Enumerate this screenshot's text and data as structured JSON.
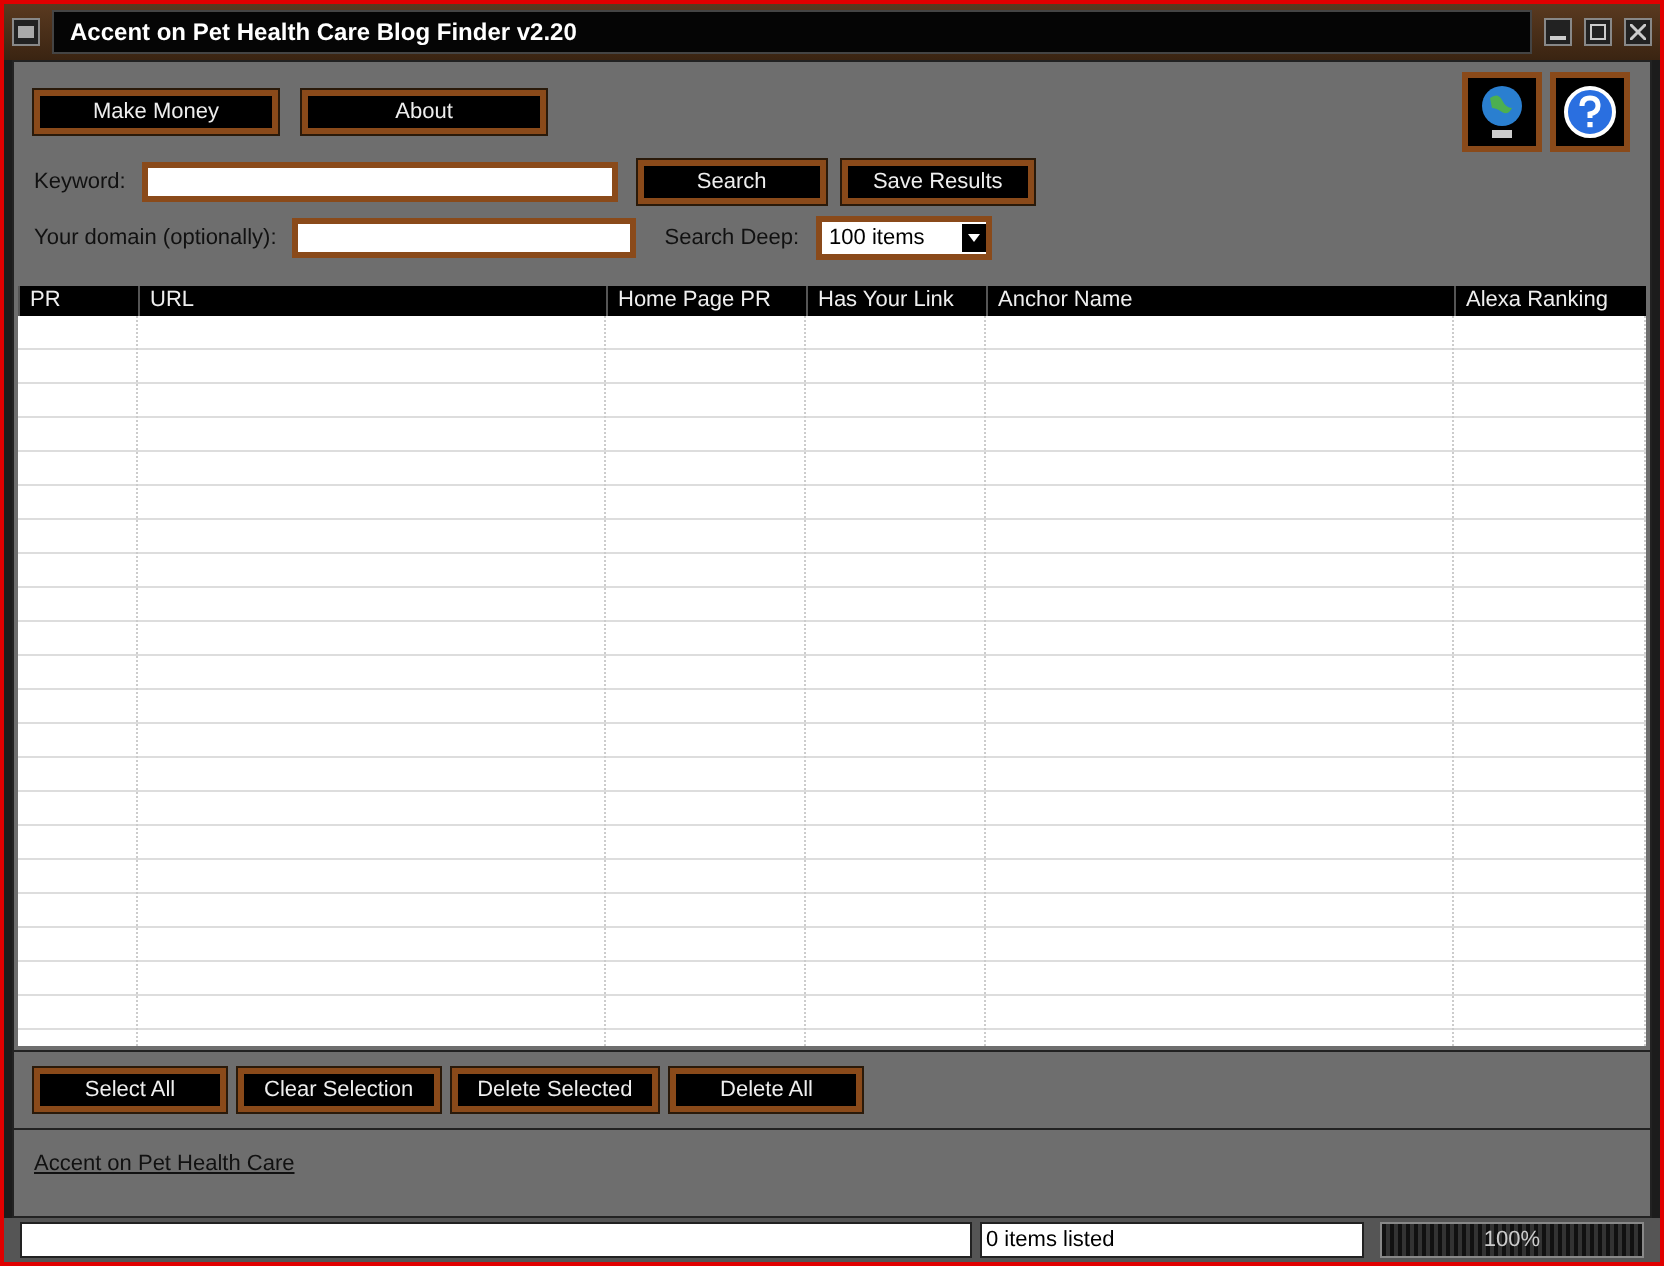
{
  "window": {
    "title": "Accent on Pet Health Care Blog Finder v2.20"
  },
  "top_buttons": [
    "Make Money",
    "About"
  ],
  "keyword": {
    "label": "Keyword:"
  },
  "search_buttons": [
    "Search",
    "Save Results"
  ],
  "domain": {
    "label": "Your domain (optionally):"
  },
  "search_deep": {
    "label": "Search Deep:",
    "value": "100 items"
  },
  "table": {
    "columns": [
      "PR",
      "URL",
      "Home Page PR",
      "Has Your Link",
      "Anchor Name",
      "Alexa Ranking"
    ]
  },
  "bottom_buttons": [
    "Select All",
    "Clear Selection",
    "Delete Selected",
    "Delete All"
  ],
  "link": "Accent on Pet Health Care",
  "status_bar": {
    "items": "0 items listed",
    "progress": {
      "level": 1,
      "reading": "100%"
    }
  }
}
